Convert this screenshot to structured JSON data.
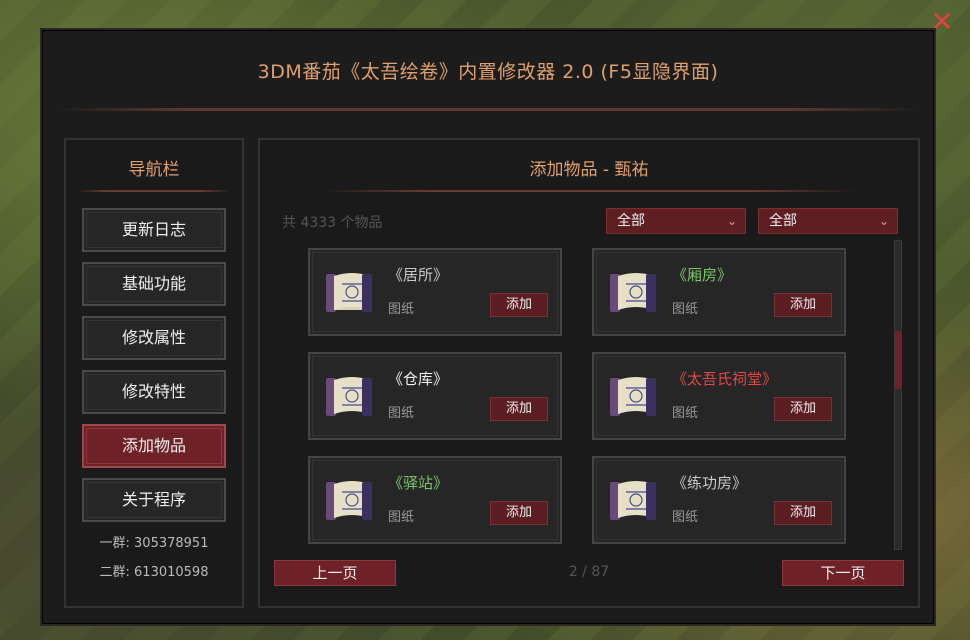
{
  "window": {
    "title": "3DM番茄《太吾绘卷》内置修改器 2.0 (F5显隐界面)"
  },
  "nav": {
    "title": "导航栏",
    "items": [
      {
        "label": "更新日志",
        "active": false
      },
      {
        "label": "基础功能",
        "active": false
      },
      {
        "label": "修改属性",
        "active": false
      },
      {
        "label": "修改特性",
        "active": false
      },
      {
        "label": "添加物品",
        "active": true
      },
      {
        "label": "关于程序",
        "active": false
      }
    ],
    "group1": "一群: 305378951",
    "group2": "二群: 613010598"
  },
  "main": {
    "title": "添加物品 - 甄祐",
    "count_text": "共 4333 个物品",
    "filter1": "全部",
    "filter2": "全部",
    "items": [
      {
        "name": "《居所》",
        "type": "图纸",
        "color": "#c8c8c8",
        "add_label": "添加"
      },
      {
        "name": "《厢房》",
        "type": "图纸",
        "color": "#7cc46a",
        "add_label": "添加"
      },
      {
        "name": "《仓库》",
        "type": "图纸",
        "color": "#f0f0f0",
        "add_label": "添加"
      },
      {
        "name": "《太吾氏祠堂》",
        "type": "图纸",
        "color": "#e04848",
        "add_label": "添加"
      },
      {
        "name": "《驿站》",
        "type": "图纸",
        "color": "#7cc46a",
        "add_label": "添加"
      },
      {
        "name": "《练功房》",
        "type": "图纸",
        "color": "#c8c8c8",
        "add_label": "添加"
      }
    ],
    "prev_label": "上一页",
    "next_label": "下一页",
    "page_indicator": "2 / 87"
  },
  "colors": {
    "accent": "#6e2126",
    "title": "#e0a070",
    "close": "#e04040"
  }
}
